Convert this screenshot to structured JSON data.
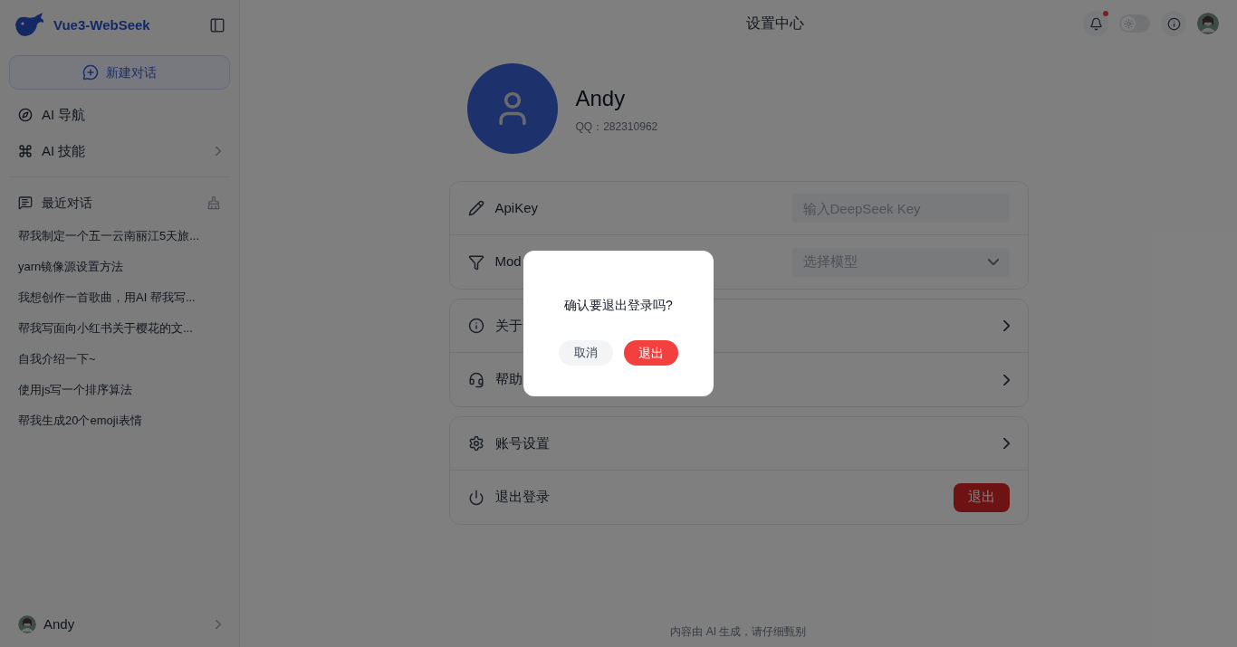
{
  "sidebar": {
    "brand": "Vue3-WebSeek",
    "new_chat": "新建对话",
    "nav": [
      {
        "kind": "compass",
        "label": "AI 导航",
        "arrow": false
      },
      {
        "kind": "command",
        "label": "AI 技能",
        "arrow": true
      }
    ],
    "recent_title": "最近对话",
    "recent": [
      "帮我制定一个五一云南丽江5天旅...",
      "yarn镜像源设置方法",
      "我想创作一首歌曲，用AI 帮我写...",
      "帮我写面向小红书关于樱花的文...",
      "自我介绍一下~",
      "使用js写一个排序算法",
      "帮我生成20个emoji表情"
    ],
    "user": "Andy"
  },
  "header": {
    "title": "设置中心",
    "unread": true,
    "dark_mode": {
      "on": false
    }
  },
  "profile": {
    "name": "Andy",
    "qq": "QQ：282310962"
  },
  "groups": [
    [
      {
        "kind": "input",
        "label": "ApiKey",
        "placeholder": "输入DeepSeek Key"
      },
      {
        "kind": "select",
        "label": "Mod",
        "placeholder": "选择模型"
      }
    ],
    [
      {
        "kind": "link",
        "label": "关于"
      },
      {
        "kind": "link",
        "label": "帮助"
      }
    ],
    [
      {
        "kind": "link",
        "label": "账号设置"
      },
      {
        "kind": "button",
        "label": "退出登录",
        "button": "退出"
      }
    ]
  ],
  "footer": "内容由 AI 生成，请仔细甄别",
  "dialog": {
    "message": "确认要退出登录吗?",
    "cancel": "取消",
    "confirm": "退出"
  }
}
